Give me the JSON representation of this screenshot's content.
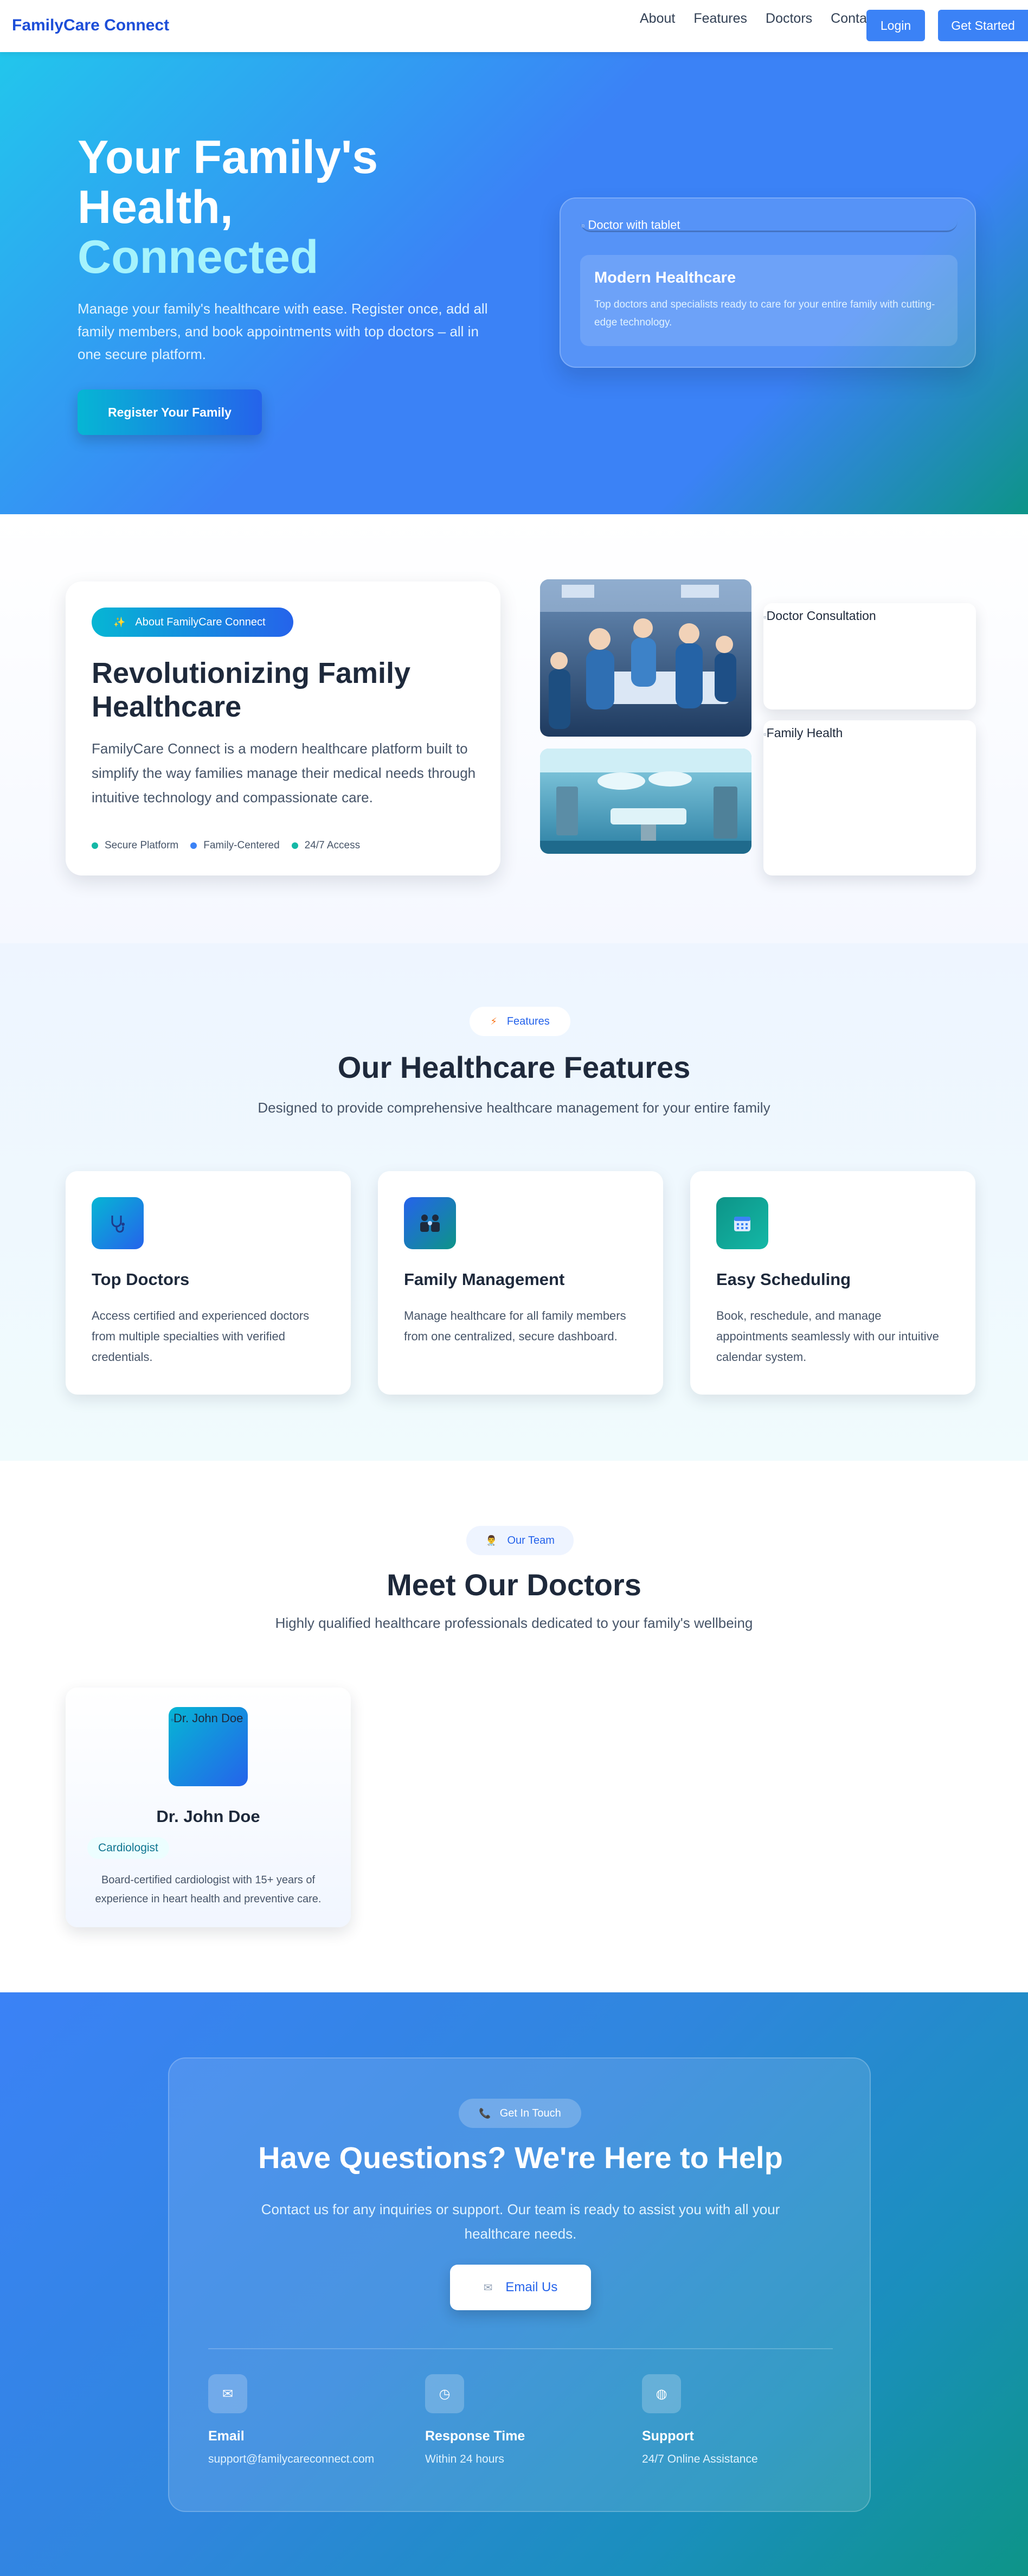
{
  "nav": {
    "brand": "FamilyCare Connect",
    "links": [
      "About",
      "Features",
      "Doctors",
      "Contact"
    ],
    "login": "Login",
    "get_started": "Get Started"
  },
  "hero": {
    "title_line1": "Your Family's",
    "title_line2": "Health,",
    "title_accent": "Connected",
    "subtitle": "Manage your family's healthcare with ease. Register once, add all family members, and book appointments with top doctors – all in one secure platform.",
    "cta": "Register Your Family",
    "image_alt": "Doctor with tablet",
    "card_title": "Modern Healthcare",
    "card_text": "Top doctors and specialists ready to care for your entire family with cutting-edge technology."
  },
  "about": {
    "badge_icon": "✨",
    "badge": "About FamilyCare Connect",
    "title": "Revolutionizing Family Healthcare",
    "text": "FamilyCare Connect is a modern healthcare platform built to simplify the way families manage their medical needs through intuitive technology and compassionate care.",
    "tags": [
      {
        "label": "Secure Platform",
        "color": "#14b8a6"
      },
      {
        "label": "Family-Centered",
        "color": "#3b82f6"
      },
      {
        "label": "24/7 Access",
        "color": "#14b8a6"
      }
    ],
    "image_alts": [
      "Doctor Consultation",
      "Family Health"
    ]
  },
  "features": {
    "pill_icon": "⚡",
    "pill": "Features",
    "title": "Our Healthcare Features",
    "subtitle": "Designed to provide comprehensive healthcare management for your entire family",
    "cards": [
      {
        "icon": "stethoscope-icon",
        "title": "Top Doctors",
        "text": "Access certified and experienced doctors from multiple specialties with verified credentials."
      },
      {
        "icon": "family-icon",
        "title": "Family Management",
        "text": "Manage healthcare for all family members from one centralized, secure dashboard."
      },
      {
        "icon": "calendar-icon",
        "title": "Easy Scheduling",
        "text": "Book, reschedule, and manage appointments seamlessly with our intuitive calendar system."
      }
    ]
  },
  "team": {
    "pill_icon": "👨‍⚕️",
    "pill": "Our Team",
    "title": "Meet Our Doctors",
    "subtitle": "Highly qualified healthcare professionals dedicated to your family's wellbeing",
    "doctor": {
      "image_alt": "Dr. John Doe",
      "name": "Dr. John Doe",
      "specialty": "Cardiologist",
      "bio": "Board-certified cardiologist with 15+ years of experience in heart health and preventive care."
    }
  },
  "contact": {
    "pill_icon": "📞",
    "pill": "Get In Touch",
    "title": "Have Questions? We're Here to Help",
    "subtitle": "Contact us for any inquiries or support. Our team is ready to assist you with all your healthcare needs.",
    "button_icon": "✉",
    "button": "Email Us",
    "info": [
      {
        "icon": "email-icon",
        "glyph": "✉",
        "title": "Email",
        "value": "support@familycareconnect.com"
      },
      {
        "icon": "clock-icon",
        "glyph": "◷",
        "title": "Response Time",
        "value": "Within 24 hours"
      },
      {
        "icon": "globe-icon",
        "glyph": "◍",
        "title": "Support",
        "value": "24/7 Online Assistance"
      }
    ]
  }
}
